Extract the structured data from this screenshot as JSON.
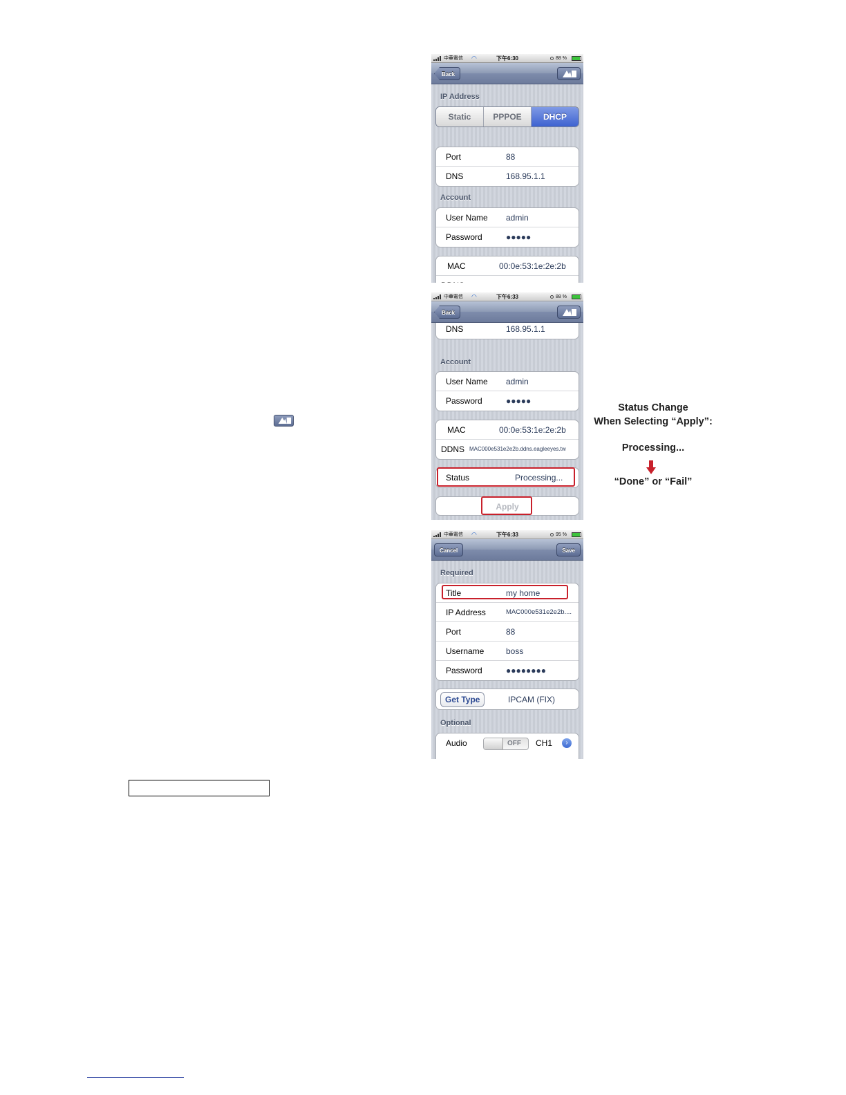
{
  "screen1": {
    "status_bar": {
      "carrier": "中華電信",
      "time": "下午6:30",
      "battery": "88 %"
    },
    "nav": {
      "back_label": "Back"
    },
    "ip_section_title": "IP Address",
    "segments": [
      "Static",
      "PPPOE",
      "DHCP"
    ],
    "active_segment": "DHCP",
    "port_label": "Port",
    "port_value": "88",
    "dns_label": "DNS",
    "dns_value": "168.95.1.1",
    "account_title": "Account",
    "username_label": "User Name",
    "username_value": "admin",
    "password_label": "Password",
    "password_value": "●●●●●",
    "mac_label": "MAC",
    "mac_value": "00:0e:53:1e:2e:2b",
    "ddns_label": "DDNS"
  },
  "screen2": {
    "status_bar": {
      "carrier": "中華電信",
      "time": "下午6:33",
      "battery": "88 %"
    },
    "nav": {
      "back_label": "Back"
    },
    "dns_label": "DNS",
    "dns_value": "168.95.1.1",
    "account_title": "Account",
    "username_label": "User Name",
    "username_value": "admin",
    "password_label": "Password",
    "password_value": "●●●●●",
    "mac_label": "MAC",
    "mac_value": "00:0e:53:1e:2e:2b",
    "ddns_label": "DDNS",
    "ddns_value": "MAC000e531e2e2b.ddns.eagleeyes.tw",
    "status_label": "Status",
    "status_value": "Processing...",
    "apply_label": "Apply"
  },
  "screen3": {
    "status_bar": {
      "carrier": "中華電信",
      "time": "下午6:33",
      "battery": "95 %"
    },
    "nav": {
      "cancel_label": "Cancel",
      "save_label": "Save"
    },
    "required_title": "Required",
    "title_label": "Title",
    "title_value": "my home",
    "ip_label": "IP Address",
    "ip_value": "MAC000e531e2e2b....",
    "port_label": "Port",
    "port_value": "88",
    "username_label": "Username",
    "username_value": "boss",
    "password_label": "Password",
    "password_value": "●●●●●●●●",
    "get_type_label": "Get Type",
    "type_value": "IPCAM (FIX)",
    "optional_title": "Optional",
    "audio_label": "Audio",
    "audio_toggle": "OFF",
    "audio_channel": "CH1"
  },
  "annotation": {
    "line1": "Status Change",
    "line2": "When Selecting “Apply”:",
    "processing": "Processing...",
    "result": "“Done” or “Fail”"
  },
  "colors": {
    "highlight": "#c8202b",
    "nav_blue": "#6d7b9c",
    "segment_active": "#3d62d0"
  }
}
